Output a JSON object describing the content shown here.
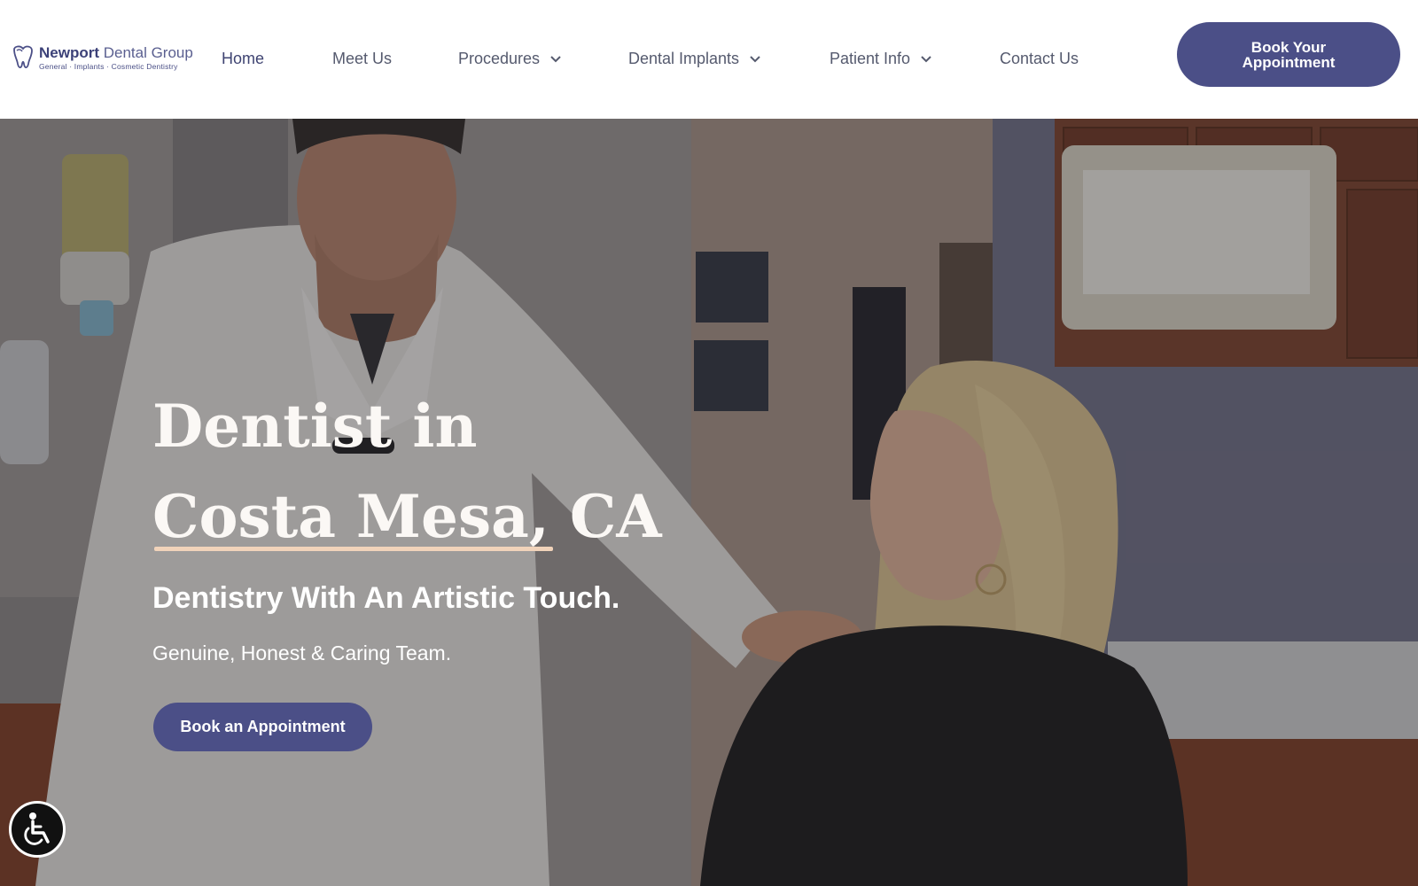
{
  "header": {
    "logo": {
      "name_bold": "Newport",
      "name_rest": " Dental Group",
      "tagline": "General · Implants · Cosmetic Dentistry"
    },
    "nav": [
      {
        "label": "Home",
        "has_dropdown": false,
        "active": true
      },
      {
        "label": "Meet Us",
        "has_dropdown": false
      },
      {
        "label": "Procedures",
        "has_dropdown": true
      },
      {
        "label": "Dental Implants",
        "has_dropdown": true
      },
      {
        "label": "Patient Info",
        "has_dropdown": true
      },
      {
        "label": "Contact Us",
        "has_dropdown": false
      }
    ],
    "book_button": "Book Your\nAppointment"
  },
  "hero": {
    "title_line1": "Dentist in",
    "title_line2": "Costa Mesa, CA",
    "subtitle": "Dentistry With An Artistic Touch.",
    "tagline": "Genuine, Honest & Caring Team.",
    "cta": "Book an Appointment"
  },
  "icons": {
    "logo": "tooth-logo-icon",
    "chevron": "chevron-down-icon",
    "accessibility": "wheelchair-accessibility-icon"
  },
  "colors": {
    "brand": "#4b4f87",
    "nav_text": "#555a6e",
    "underline_accent": "#f1d3ba"
  }
}
